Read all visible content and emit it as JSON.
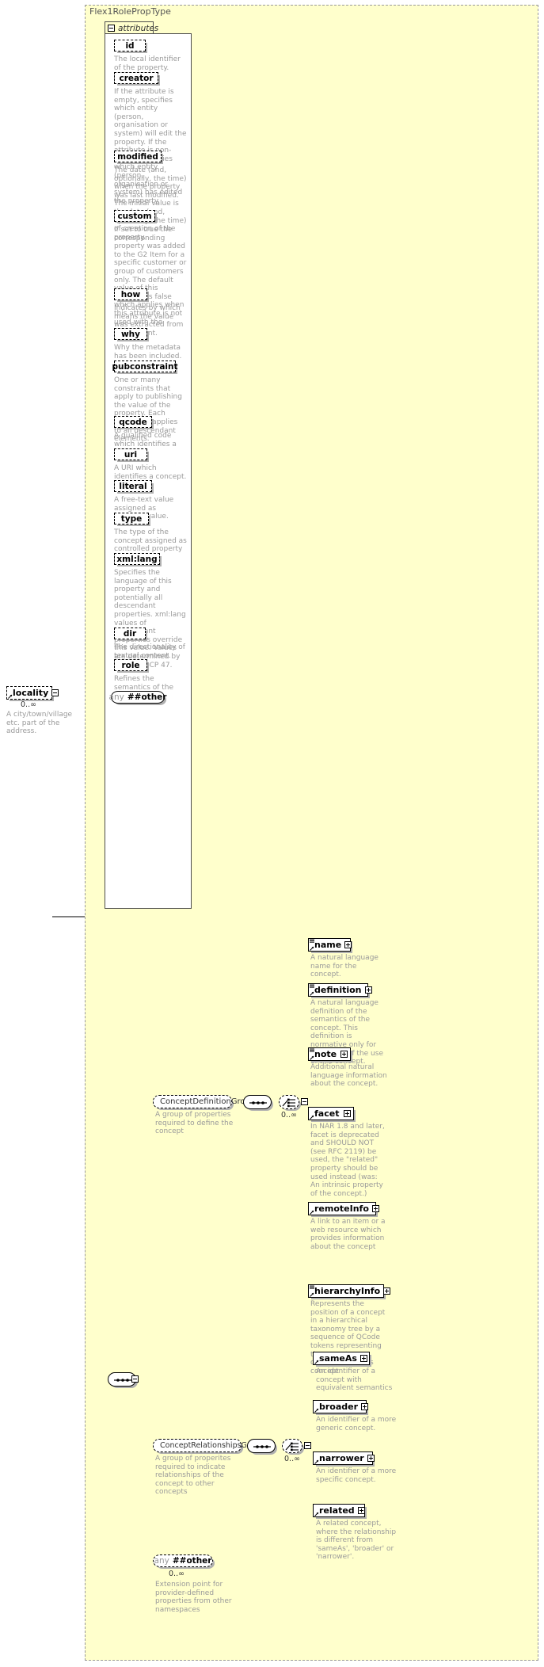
{
  "diagram": {
    "type_title": "Flex1RolePropType",
    "attributes_tab_label": "attributes",
    "cardinality_zero_inf": "0..∞",
    "any_keyword": "any",
    "any_namespace": "##other"
  },
  "attributes": [
    {
      "name": "id",
      "desc": "The local identifier of the property."
    },
    {
      "name": "creator",
      "desc": "If the attribute is empty, specifies which entity (person, organisation or system) will edit the property. If the attribute is non-empty, specifies which entity (person, organisation or system) has edited the property."
    },
    {
      "name": "modified",
      "desc": "The date (and, optionally, the time) when the property was last modified. The initial value is the date (and, optionally, the time) of creation of the property."
    },
    {
      "name": "custom",
      "desc": "If set to true the corresponding property was added to the G2 Item for a specific customer or group of customers only. The default value of this property is false which applies when this attribute is not used with the property."
    },
    {
      "name": "how",
      "desc": "Indicates by which means the value was extracted from the content."
    },
    {
      "name": "why",
      "desc": "Why the metadata has been included."
    },
    {
      "name": "pubconstraint",
      "desc": "One or many constraints that apply to publishing the value of the property. Each constraint applies to all descendant elements."
    },
    {
      "name": "qcode",
      "desc": "A qualified code which identifies a concept."
    },
    {
      "name": "uri",
      "desc": "A URI which identifies a concept."
    },
    {
      "name": "literal",
      "desc": "A free-text value assigned as property value."
    },
    {
      "name": "type",
      "desc": "The type of the concept assigned as controlled property value."
    },
    {
      "name": "xml:lang",
      "desc": "Specifies the language of this property and potentially all descendant properties. xml:lang values of descendant properties override this value. Values are determined by Internet BCP 47."
    },
    {
      "name": "dir",
      "desc": "The directionality of textual content."
    },
    {
      "name": "role",
      "desc": "Refines the semantics of the property"
    }
  ],
  "locality": {
    "name": "locality",
    "cardinality": "0..∞",
    "desc": "A city/town/village etc. part of the address."
  },
  "concept_definition_group": {
    "name": "ConceptDefinitionGroup",
    "desc": "A group of properties required to define the concept",
    "cardinality": "0..∞",
    "elements": [
      {
        "name": "name",
        "desc": "A natural language name for the concept."
      },
      {
        "name": "definition",
        "desc": "A natural language definition of the semantics of the concept. This definition is normative only for the scope of the use of this concept."
      },
      {
        "name": "note",
        "desc": "Additional natural language information about the concept."
      },
      {
        "name": "facet",
        "desc": "In NAR 1.8 and later, facet is deprecated and SHOULD NOT (see RFC 2119) be used, the \"related\" property should be used instead (was: An intrinsic property of the concept.)"
      },
      {
        "name": "remoteInfo",
        "desc": "A link to an item or a web resource which provides information about the concept"
      },
      {
        "name": "hierarchyInfo",
        "desc": "Represents the position of a concept in a hierarchical taxonomy tree by a sequence of QCode tokens representing the ancestor concepts and this concept"
      }
    ]
  },
  "concept_relationships_group": {
    "name": "ConceptRelationshipsGroup",
    "desc": "A group of properites required to indicate relationships of the concept to other concepts",
    "cardinality": "0..∞",
    "elements": [
      {
        "name": "sameAs",
        "desc": "An identifier of a concept with equivalent semantics"
      },
      {
        "name": "broader",
        "desc": "An identifier of a more generic concept."
      },
      {
        "name": "narrower",
        "desc": "An identifier of a more specific concept."
      },
      {
        "name": "related",
        "desc": "A related concept, where the relationship is different from 'sameAs', 'broader' or 'narrower'."
      }
    ]
  },
  "extension_any": {
    "keyword": "any",
    "namespace": "##other",
    "cardinality": "0..∞",
    "desc": "Extension point for provider-defined properties from other namespaces"
  }
}
